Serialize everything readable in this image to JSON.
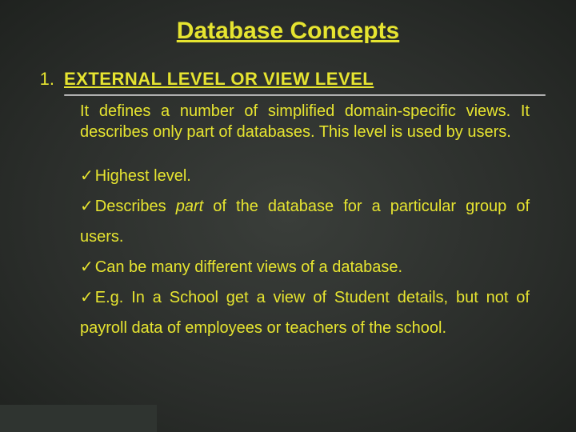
{
  "title": "Database Concepts",
  "section": {
    "number": "1.",
    "heading": "EXTERNAL LEVEL OR VIEW LEVEL",
    "description": "It defines a number of simplified domain-specific views. It describes only part of databases. This level is used by users.",
    "bullets": [
      {
        "pre": "Highest level."
      },
      {
        "pre": "Describes ",
        "italic": "part",
        "post": " of the database for a particular group of users."
      },
      {
        "pre": "Can be many different views of a database."
      },
      {
        "pre": "E.g. In a School get a view of Student details, but not of payroll data of employees or teachers of the school."
      }
    ]
  },
  "check_glyph": "✓"
}
